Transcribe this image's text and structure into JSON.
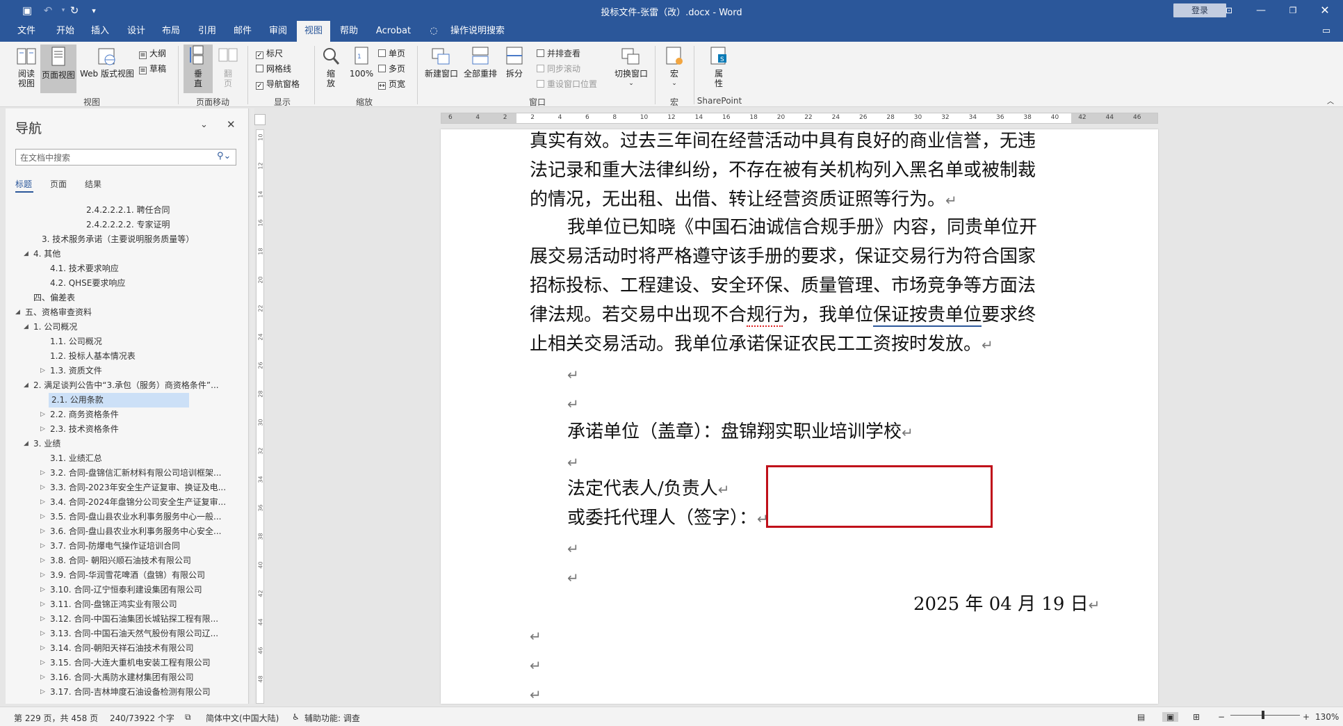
{
  "titlebar": {
    "title": "投标文件-张雷（改）.docx  -  Word",
    "login": "登录",
    "icons": {
      "save": "save-icon",
      "undo": "undo-icon",
      "redo": "redo-icon",
      "customize": "customize-icon",
      "ribbon_display": "ribbon-display-icon",
      "minimize": "minimize-icon",
      "restore": "restore-icon",
      "close": "close-icon"
    }
  },
  "menu": {
    "items": [
      "文件",
      "开始",
      "插入",
      "设计",
      "布局",
      "引用",
      "邮件",
      "审阅",
      "视图",
      "帮助",
      "Acrobat",
      "操作说明搜索"
    ],
    "active": "视图",
    "share_icon": "comment-icon"
  },
  "ribbon": {
    "views": {
      "read": [
        "阅读",
        "视图"
      ],
      "print": "页面视图",
      "web": "Web 版式视图",
      "outline": "大纲",
      "draft": "草稿",
      "label": "视图"
    },
    "page_move": {
      "vertical": [
        "垂",
        "直"
      ],
      "side": [
        "翻",
        "页"
      ],
      "label": "页面移动"
    },
    "show": {
      "ruler": "标尺",
      "gridlines": "网格线",
      "nav_pane": "导航窗格",
      "label": "显示",
      "ruler_checked": true,
      "gridlines_checked": false,
      "nav_checked": true
    },
    "zoom": {
      "zoom": [
        "缩",
        "放"
      ],
      "pct": "100%",
      "one_page": "单页",
      "multi_page": "多页",
      "page_width": "页宽",
      "label": "缩放"
    },
    "window": {
      "new": "新建窗口",
      "arrange": "全部重排",
      "split": "拆分",
      "side_by_side": "并排查看",
      "sync_scroll": "同步滚动",
      "reset_pos": "重设窗口位置",
      "switch": [
        "切换窗口"
      ],
      "label": "窗口"
    },
    "macros": {
      "macros": "宏",
      "label": "宏"
    },
    "sharepoint": {
      "props": [
        "属",
        "性"
      ],
      "label": "SharePoint"
    }
  },
  "nav": {
    "title": "导航",
    "search_placeholder": "在文档中搜索",
    "tabs": [
      "标题",
      "页面",
      "结果"
    ],
    "active_tab": "标题",
    "items": [
      {
        "text": "2.4.2.2.2.1. 聘任合同",
        "t": ""
      },
      {
        "text": "2.4.2.2.2.2. 专家证明",
        "t": ""
      },
      {
        "text": "3. 技术服务承诺（主要说明服务质量等）",
        "t": ""
      },
      {
        "text": "4. 其他",
        "t": "◢"
      },
      {
        "text": "4.1. 技术要求响应",
        "t": ""
      },
      {
        "text": "4.2. QHSE要求响应",
        "t": ""
      },
      {
        "text": "四、偏差表",
        "t": ""
      },
      {
        "text": "五、资格审查资料",
        "t": "◢"
      },
      {
        "text": "1. 公司概况",
        "t": "◢"
      },
      {
        "text": "1.1. 公司概况",
        "t": ""
      },
      {
        "text": "1.2. 投标人基本情况表",
        "t": ""
      },
      {
        "text": "1.3. 资质文件",
        "t": "▷"
      },
      {
        "text": "2. 满足谈判公告中“3.承包（服务）商资格条件”...",
        "t": "◢"
      },
      {
        "text": "2.1. 公用条款",
        "t": "▷"
      },
      {
        "text": "2.2. 商务资格条件",
        "t": "▷"
      },
      {
        "text": "2.3. 技术资格条件",
        "t": "▷"
      },
      {
        "text": "3. 业绩",
        "t": "◢"
      },
      {
        "text": "3.1. 业绩汇总",
        "t": ""
      },
      {
        "text": "3.2. 合同-盘锦信汇新材料有限公司培训框架...",
        "t": "▷"
      },
      {
        "text": "3.3. 合同-2023年安全生产证复审、换证及电...",
        "t": "▷"
      },
      {
        "text": "3.4. 合同-2024年盘锦分公司安全生产证复审...",
        "t": "▷"
      },
      {
        "text": "3.5. 合同-盘山县农业水利事务服务中心一般...",
        "t": "▷"
      },
      {
        "text": "3.6. 合同-盘山县农业水利事务服务中心安全...",
        "t": "▷"
      },
      {
        "text": "3.7. 合同-防爆电气操作证培训合同",
        "t": "▷"
      },
      {
        "text": "3.8. 合同- 朝阳兴顺石油技术有限公司",
        "t": "▷"
      },
      {
        "text": "3.9. 合同-华润雪花啤酒（盘锦）有限公司",
        "t": "▷"
      },
      {
        "text": "3.10. 合同-辽宁恒泰利建设集团有限公司",
        "t": "▷"
      },
      {
        "text": "3.11. 合同-盘锦正鸿实业有限公司",
        "t": "▷"
      },
      {
        "text": "3.12. 合同-中国石油集团长城钻探工程有限...",
        "t": "▷"
      },
      {
        "text": "3.13. 合同-中国石油天然气股份有限公司辽...",
        "t": "▷"
      },
      {
        "text": "3.14. 合同-朝阳天祥石油技术有限公司",
        "t": "▷"
      },
      {
        "text": "3.15. 合同-大连大重机电安装工程有限公司",
        "t": "▷"
      },
      {
        "text": "3.16. 合同-大禹防水建材集团有限公司",
        "t": "▷"
      },
      {
        "text": "3.17. 合同-吉林坤度石油设备检测有限公司",
        "t": "▷"
      }
    ]
  },
  "ruler": {
    "h": [
      "6",
      "4",
      "2",
      "2",
      "4",
      "6",
      "8",
      "10",
      "12",
      "14",
      "16",
      "18",
      "20",
      "22",
      "24",
      "26",
      "28",
      "30",
      "32",
      "34",
      "36",
      "38",
      "40",
      "42",
      "44",
      "46"
    ],
    "v": [
      "10",
      "12",
      "14",
      "16",
      "18",
      "20",
      "22",
      "24",
      "26",
      "28",
      "30",
      "32",
      "34",
      "36",
      "38",
      "40",
      "42",
      "44",
      "46",
      "48"
    ]
  },
  "document": {
    "p1": [
      "真实有效。过去三年间在经营活动中具有良好的商业信誉，无违",
      "法记录和重大法律纠纷，不存在被有关机构列入黑名单或被制裁",
      "的情况，无出租、出借、转让经营资质证照等行为。"
    ],
    "p2_l1": "我单位已知晓《中国石油诚信合规手册》内容，同贵单位开",
    "p2": [
      "展交易活动时将严格遵守该手册的要求，保证交易行为符合国家",
      "招标投标、工程建设、安全环保、质量管理、市场竞争等方面法"
    ],
    "p2_l4": {
      "a": "律法规。若交易中出现不合",
      "b": "规行",
      "c": "为，我单位",
      "d": "保证按贵单位",
      "e": "要求终"
    },
    "p2_l5": "止相关交易活动。我单位承诺保证农民工工资按时发放。",
    "sign_unit": "承诺单位（盖章）：盘锦翔实职业培训学校",
    "legal_rep": "法定代表人/负责人",
    "agent": "或委托代理人（签字）：",
    "date": "2025 年 04 月 19 日",
    "para_mark": "↵"
  },
  "status": {
    "page": "第 229 页，共 458 页",
    "words": "240/73922 个字",
    "lang": "简体中文(中国大陆)",
    "access": "辅助功能: 调查",
    "zoom": "130%"
  }
}
